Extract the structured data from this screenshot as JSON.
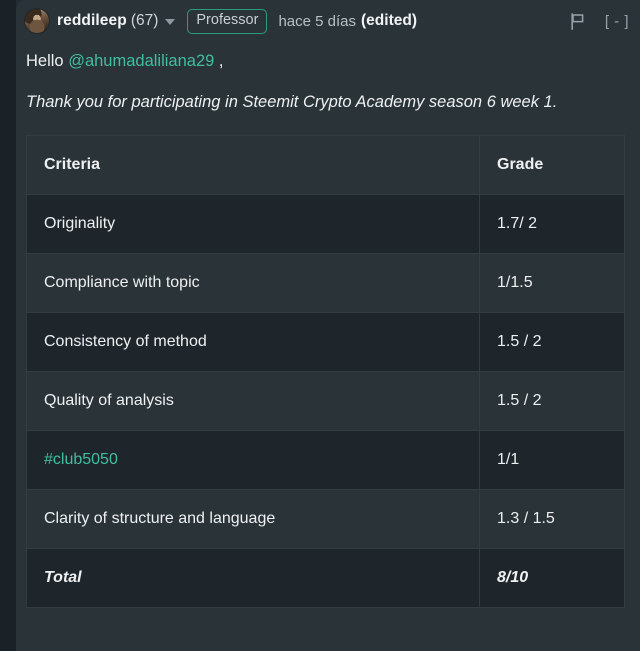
{
  "header": {
    "avatar_name": "user-avatar",
    "author": "reddileep",
    "reputation": "(67)",
    "role_badge": "Professor",
    "timestamp": "hace 5 días",
    "edited_label": "(edited)",
    "flag_icon": "flag-icon",
    "collapse_label": "[ - ]"
  },
  "body": {
    "greeting_prefix": "Hello",
    "mention": "@ahumadaliliana29",
    "greeting_suffix": ",",
    "intro_line": "Thank you for participating in Steemit Crypto Academy season 6 week 1."
  },
  "table": {
    "columns": [
      "Criteria",
      "Grade"
    ],
    "rows": [
      {
        "criteria": "Originality",
        "grade": "1.7/ 2",
        "is_link": false
      },
      {
        "criteria": "Compliance with topic",
        "grade": "1/1.5",
        "is_link": false
      },
      {
        "criteria": "Consistency of method",
        "grade": "1.5 / 2",
        "is_link": false
      },
      {
        "criteria": "Quality of analysis",
        "grade": "1.5 / 2",
        "is_link": false
      },
      {
        "criteria": "#club5050",
        "grade": "1/1",
        "is_link": true
      },
      {
        "criteria": "Clarity of structure and language",
        "grade": "1.3 / 1.5",
        "is_link": false
      }
    ],
    "total": {
      "criteria": "Total",
      "grade": "8/10"
    }
  },
  "colors": {
    "page_background": "#1b2227",
    "comment_background": "#2a3338",
    "row_alt_background": "#1e262c",
    "accent_teal": "#3fbfa0",
    "badge_border": "#2e9b7a",
    "text_primary": "#eef0f1",
    "text_muted": "#b7c0c5",
    "table_border": "#323c42"
  }
}
